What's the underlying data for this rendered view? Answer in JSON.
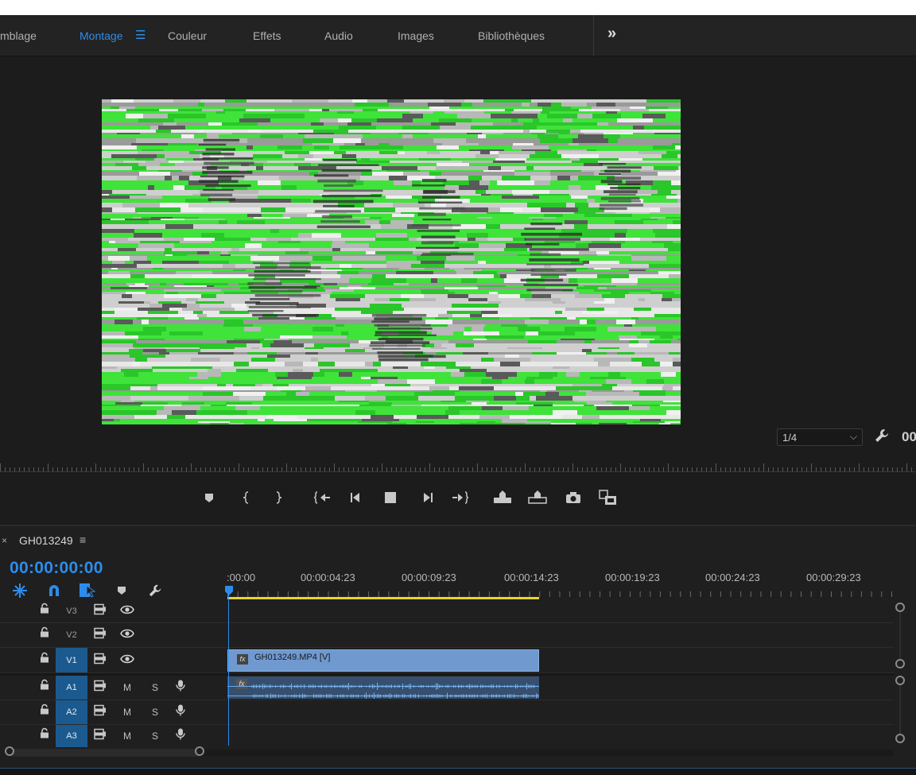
{
  "workspaces": {
    "tabs": [
      {
        "label": "mblage",
        "active": false
      },
      {
        "label": "Montage",
        "active": true
      },
      {
        "label": "Couleur",
        "active": false
      },
      {
        "label": "Effets",
        "active": false
      },
      {
        "label": "Audio",
        "active": false
      },
      {
        "label": "Images",
        "active": false
      },
      {
        "label": "Bibliothèques",
        "active": false
      }
    ],
    "menu_icon": "hamburger-icon",
    "more_label": "»"
  },
  "monitor": {
    "zoom_value": "1/4",
    "timecode_partial": "00",
    "accent": "#2d8ceb"
  },
  "transport": {
    "buttons": [
      "add-marker-icon",
      "mark-in-icon",
      "mark-out-icon",
      "go-to-in-icon",
      "step-back-icon",
      "stop-icon",
      "step-forward-icon",
      "go-to-out-icon",
      "lift-icon",
      "extract-icon",
      "export-frame-icon",
      "compare-view-icon"
    ]
  },
  "timeline": {
    "sequence_name": "GH013249",
    "close_label": "×",
    "menu_label": "≡",
    "timecode": "00:00:00:00",
    "ruler_labels": [
      ":00:00",
      "00:00:04:23",
      "00:00:09:23",
      "00:00:14:23",
      "00:00:19:23",
      "00:00:24:23",
      "00:00:29:23"
    ],
    "tracks": {
      "video": [
        {
          "name": "V3",
          "targeted": false
        },
        {
          "name": "V2",
          "targeted": false
        },
        {
          "name": "V1",
          "targeted": true
        }
      ],
      "audio": [
        {
          "name": "A1",
          "targeted": true,
          "mute": "M",
          "solo": "S"
        },
        {
          "name": "A2",
          "targeted": true,
          "mute": "M",
          "solo": "S"
        },
        {
          "name": "A3",
          "targeted": true,
          "mute": "M",
          "solo": "S"
        }
      ]
    },
    "video_clip": {
      "name": "GH013249.MP4 [V]",
      "fx": "fx"
    },
    "audio_clip": {
      "fx": "fx"
    },
    "colors": {
      "video_clip": "#6f99cf",
      "audio_clip": "#364f6e",
      "work_area": "#e8d62a",
      "target": "#1b5a8e"
    }
  }
}
